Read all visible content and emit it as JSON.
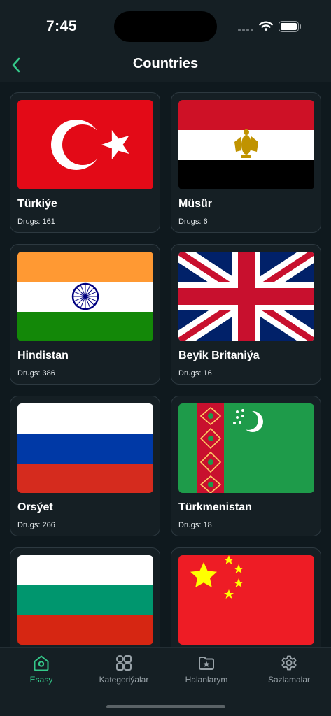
{
  "status": {
    "time": "7:45"
  },
  "nav": {
    "title": "Countries"
  },
  "countries": [
    {
      "name": "Türkiýe",
      "drugs": "Drugs: 161"
    },
    {
      "name": "Müsür",
      "drugs": "Drugs: 6"
    },
    {
      "name": "Hindistan",
      "drugs": "Drugs: 386"
    },
    {
      "name": "Beyik Britaniýa",
      "drugs": "Drugs: 16"
    },
    {
      "name": "Orsýet",
      "drugs": "Drugs: 266"
    },
    {
      "name": "Türkmenistan",
      "drugs": "Drugs: 18"
    },
    {
      "name": "",
      "drugs": ""
    },
    {
      "name": "",
      "drugs": ""
    }
  ],
  "tabs": [
    {
      "label": "Esasy",
      "icon": "home-icon",
      "active": true
    },
    {
      "label": "Kategoriýalar",
      "icon": "grid-icon",
      "active": false
    },
    {
      "label": "Halanlarym",
      "icon": "favorite-folder-icon",
      "active": false
    },
    {
      "label": "Sazlamalar",
      "icon": "gear-icon",
      "active": false
    }
  ],
  "colors": {
    "accent": "#34c98a",
    "background": "#0f191e",
    "card": "#151f24"
  }
}
